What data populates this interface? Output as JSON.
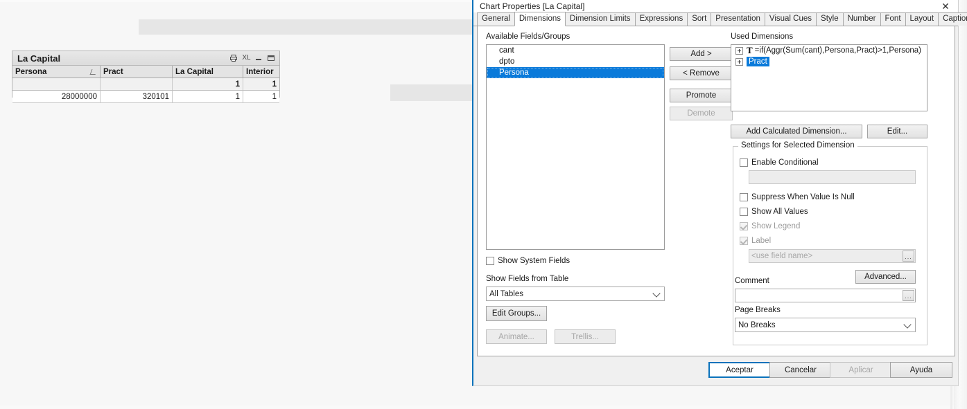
{
  "chart_object": {
    "title": "La Capital",
    "caption_icons": [
      "print-icon",
      "excel-export-icon",
      "minimize-icon",
      "maximize-icon"
    ],
    "excel_label": "XL",
    "columns": [
      "Persona",
      "Pract",
      "La Capital",
      "Interior"
    ],
    "total_row": [
      "",
      "",
      "1",
      "1"
    ],
    "rows": [
      [
        "28000000",
        "320101",
        "1",
        "1"
      ]
    ]
  },
  "dialog": {
    "title": "Chart Properties [La Capital]",
    "close_label": "✕",
    "tabs": [
      {
        "label": "General",
        "active": false
      },
      {
        "label": "Dimensions",
        "active": true
      },
      {
        "label": "Dimension Limits",
        "active": false
      },
      {
        "label": "Expressions",
        "active": false
      },
      {
        "label": "Sort",
        "active": false
      },
      {
        "label": "Presentation",
        "active": false
      },
      {
        "label": "Visual Cues",
        "active": false
      },
      {
        "label": "Style",
        "active": false
      },
      {
        "label": "Number",
        "active": false
      },
      {
        "label": "Font",
        "active": false
      },
      {
        "label": "Layout",
        "active": false
      },
      {
        "label": "Caption",
        "active": false
      }
    ],
    "available_fields": {
      "label": "Available Fields/Groups",
      "items": [
        {
          "name": "cant",
          "selected": false
        },
        {
          "name": "dpto",
          "selected": false
        },
        {
          "name": "Persona",
          "selected": true
        }
      ]
    },
    "transfer_buttons": [
      {
        "label": "Add >",
        "disabled": false
      },
      {
        "label": "< Remove",
        "disabled": false
      },
      {
        "label": "Promote",
        "disabled": false
      },
      {
        "label": "Demote",
        "disabled": true
      }
    ],
    "used_dimensions": {
      "label": "Used Dimensions",
      "items": [
        {
          "text": "=if(Aggr(Sum(cant),Persona,Pract)>1,Persona)",
          "is_expression": true,
          "selected": false
        },
        {
          "text": "Pract",
          "is_expression": false,
          "selected": true
        }
      ]
    },
    "add_calculated_button": "Add Calculated Dimension...",
    "edit_button": "Edit...",
    "settings_group": {
      "title": "Settings for Selected Dimension",
      "enable_conditional": {
        "label": "Enable Conditional",
        "checked": false,
        "disabled": false
      },
      "conditional_input": {
        "value": "",
        "disabled": true
      },
      "suppress_when_null": {
        "label": "Suppress When Value Is Null",
        "checked": false,
        "disabled": false
      },
      "show_all_values": {
        "label": "Show All Values",
        "checked": false,
        "disabled": false
      },
      "show_legend": {
        "label": "Show Legend",
        "checked": true,
        "disabled": true
      },
      "label_checkbox": {
        "label": "Label",
        "checked": true,
        "disabled": true
      },
      "label_input": {
        "placeholder": "<use field name>",
        "value": "",
        "disabled": true
      },
      "advanced_button": "Advanced...",
      "comment_label": "Comment",
      "comment_input": {
        "value": ""
      },
      "page_breaks_label": "Page Breaks",
      "page_breaks_value": "No Breaks",
      "ellipsis_label": "..."
    },
    "show_system_fields": {
      "label": "Show System Fields",
      "checked": false
    },
    "show_fields_from_table_label": "Show Fields from Table",
    "show_fields_from_table_value": "All Tables",
    "edit_groups_button": "Edit Groups...",
    "animate_button": {
      "label": "Animate...",
      "disabled": true
    },
    "trellis_button": {
      "label": "Trellis...",
      "disabled": true
    },
    "footer_buttons": [
      {
        "label": "Aceptar",
        "disabled": false,
        "default": true
      },
      {
        "label": "Cancelar",
        "disabled": false,
        "default": false
      },
      {
        "label": "Aplicar",
        "disabled": true,
        "default": false
      },
      {
        "label": "Ayuda",
        "disabled": false,
        "default": false
      }
    ]
  },
  "colors": {
    "selection_blue": "#0a7ada",
    "focus_blue": "#0a72bb",
    "dialog_bg": "#f0f0f0",
    "pane_bg": "#ffffff",
    "desktop_bg": "#f7f7f7"
  }
}
